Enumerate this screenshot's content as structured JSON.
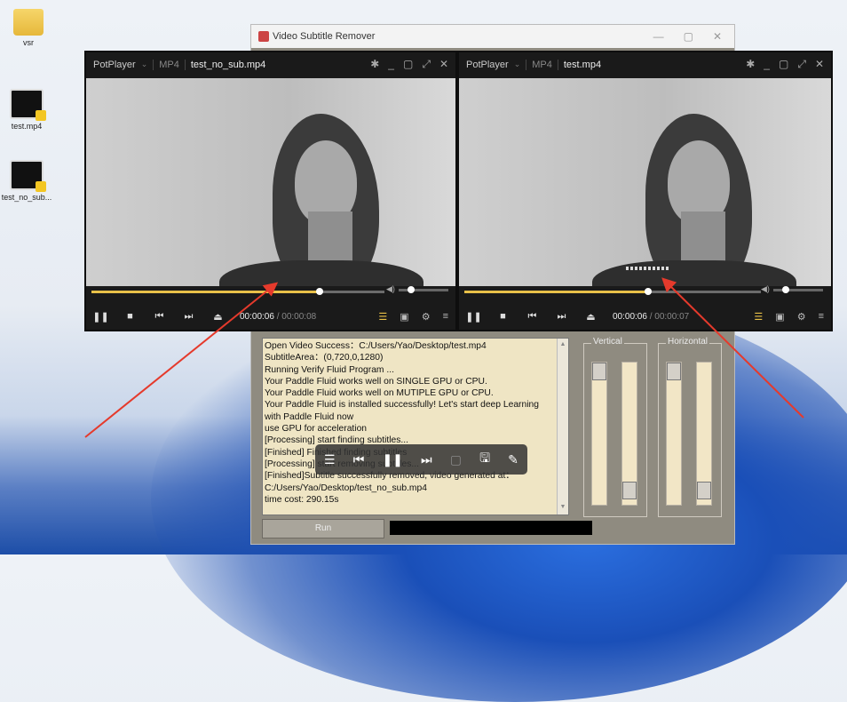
{
  "desktop": {
    "icons": [
      {
        "label": "vsr",
        "kind": "folder"
      },
      {
        "label": "test.mp4",
        "kind": "video"
      },
      {
        "label": "test_no_sub...",
        "kind": "video"
      }
    ]
  },
  "vsr_window": {
    "title": "Video Subtitle Remover",
    "log_lines": [
      "Open Video Success：C:/Users/Yao/Desktop/test.mp4",
      "SubtitleArea：(0,720,0,1280)",
      "Running Verify Fluid Program ...",
      "Your Paddle Fluid works well on SINGLE GPU or CPU.",
      "Your Paddle Fluid works well on MUTIPLE GPU or CPU.",
      "Your Paddle Fluid is installed successfully! Let's start deep Learning with Paddle Fluid now",
      "use GPU for acceleration",
      "[Processing] start finding subtitles...",
      "[Finished] Finished finding subtitles",
      "[Processing] start removing subtitles...",
      "[Finished]Subtitle successfully removed, video generated at：C:/Users/Yao/Desktop/test_no_sub.mp4",
      "time cost: 290.15s"
    ],
    "vertical_label": "Vertical",
    "horizontal_label": "Horizontal",
    "run_label": "Run"
  },
  "player_left": {
    "app": "PotPlayer",
    "format": "MP4",
    "filename": "test_no_sub.mp4",
    "time_current": "00:00:06",
    "time_total": "00:00:08",
    "progress": 0.78
  },
  "player_right": {
    "app": "PotPlayer",
    "format": "MP4",
    "filename": "test.mp4",
    "time_current": "00:00:06",
    "time_total": "00:00:07",
    "progress": 0.62
  },
  "colors": {
    "accent": "#e8c048",
    "log_bg": "#efe5c4",
    "arrow": "#e53a2c"
  }
}
